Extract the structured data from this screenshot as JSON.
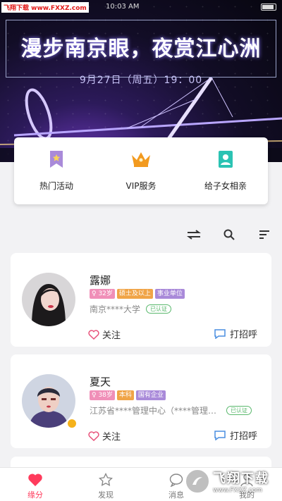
{
  "watermark": "飞翔下载 www.FXXZ.com",
  "status": {
    "time": "10:03 AM"
  },
  "banner": {
    "title": "漫步南京眼，夜赏江心洲",
    "subtitle": "9月27日（周五）19：00"
  },
  "quick_menu": [
    {
      "label": "热门活动",
      "icon": "bookmark-star-icon"
    },
    {
      "label": "VIP服务",
      "icon": "crown-icon"
    },
    {
      "label": "给子女相亲",
      "icon": "contact-card-icon"
    }
  ],
  "toolbar": {
    "icons": [
      "switch-icon",
      "search-icon",
      "sort-icon"
    ]
  },
  "profiles": [
    {
      "name": "露娜",
      "tags": [
        {
          "text": "♀ 32岁",
          "type": "age"
        },
        {
          "text": "硕士及以上",
          "type": "edu"
        },
        {
          "text": "事业单位",
          "type": "job"
        }
      ],
      "school": "南京****大学",
      "verified": "已认证",
      "follow": "关注",
      "greet": "打招呼"
    },
    {
      "name": "夏天",
      "tags": [
        {
          "text": "♀ 38岁",
          "type": "age"
        },
        {
          "text": "本科",
          "type": "edu"
        },
        {
          "text": "国有企业",
          "type": "job"
        }
      ],
      "school": "江苏省****管理中心（****管理…",
      "verified": "已认证",
      "follow": "关注",
      "greet": "打招呼"
    }
  ],
  "tabs": [
    {
      "label": "缘分",
      "icon": "heart-icon",
      "active": true
    },
    {
      "label": "发现",
      "icon": "star-icon",
      "active": false
    },
    {
      "label": "消息",
      "icon": "chat-icon",
      "active": false
    },
    {
      "label": "我的",
      "icon": "person-icon",
      "active": false
    }
  ],
  "logo_watermark": {
    "main": "飞翔下载",
    "url": "www.FXXZ.com"
  },
  "colors": {
    "accent": "#ff3b5c",
    "verified": "#59b86c",
    "age_tag": "#f08fb8",
    "edu_tag": "#f0a447",
    "job_tag": "#a98ad9"
  }
}
